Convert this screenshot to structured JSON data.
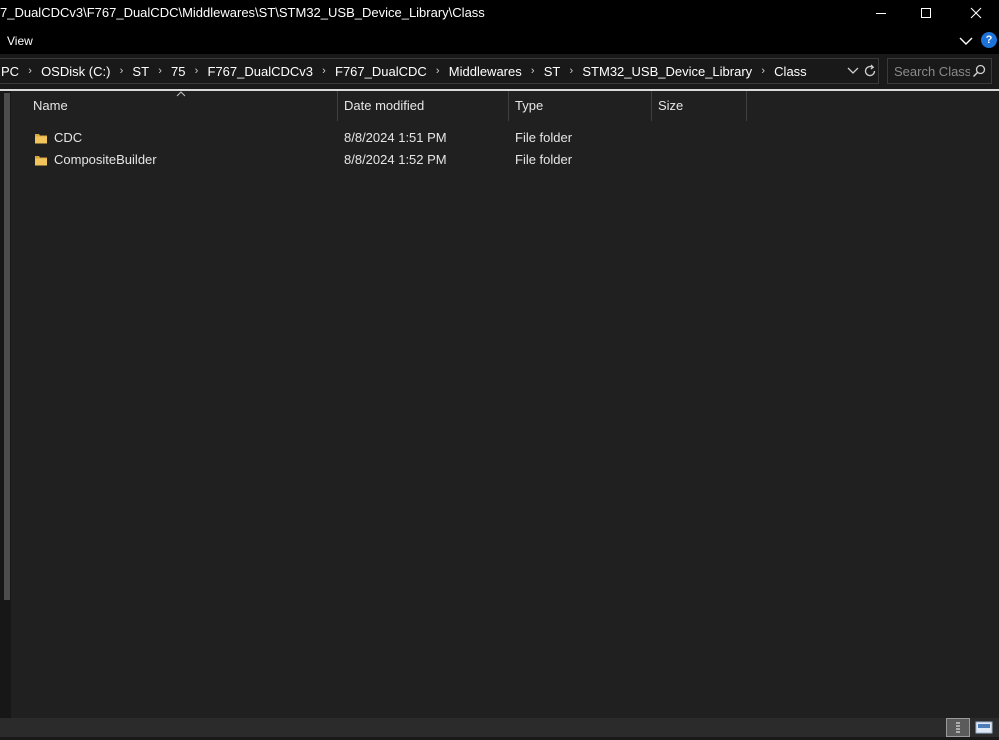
{
  "window": {
    "title": "7_DualCDCv3\\F767_DualCDC\\Middlewares\\ST\\STM32_USB_Device_Library\\Class"
  },
  "ribbon": {
    "view_tab": "View"
  },
  "address": {
    "crumbs": [
      "PC",
      "OSDisk (C:)",
      "ST",
      "75",
      "F767_DualCDCv3",
      "F767_DualCDC",
      "Middlewares",
      "ST",
      "STM32_USB_Device_Library",
      "Class"
    ]
  },
  "search": {
    "placeholder": "Search Class",
    "value": ""
  },
  "columns": {
    "name": "Name",
    "date": "Date modified",
    "type": "Type",
    "size": "Size"
  },
  "files": [
    {
      "name": "CDC",
      "date": "8/8/2024 1:51 PM",
      "type": "File folder",
      "size": ""
    },
    {
      "name": "CompositeBuilder",
      "date": "8/8/2024 1:52 PM",
      "type": "File folder",
      "size": ""
    }
  ],
  "colors": {
    "background": "#202020",
    "titlebar": "#000000",
    "folder": "#f2c55c",
    "help": "#1e73d8"
  },
  "icons": {
    "minimize": "minimize-icon",
    "maximize": "maximize-icon",
    "close": "close-icon",
    "expand_ribbon": "chevron-down-icon",
    "help": "help-icon",
    "refresh": "refresh-icon",
    "search": "search-icon",
    "folder": "folder-icon"
  }
}
